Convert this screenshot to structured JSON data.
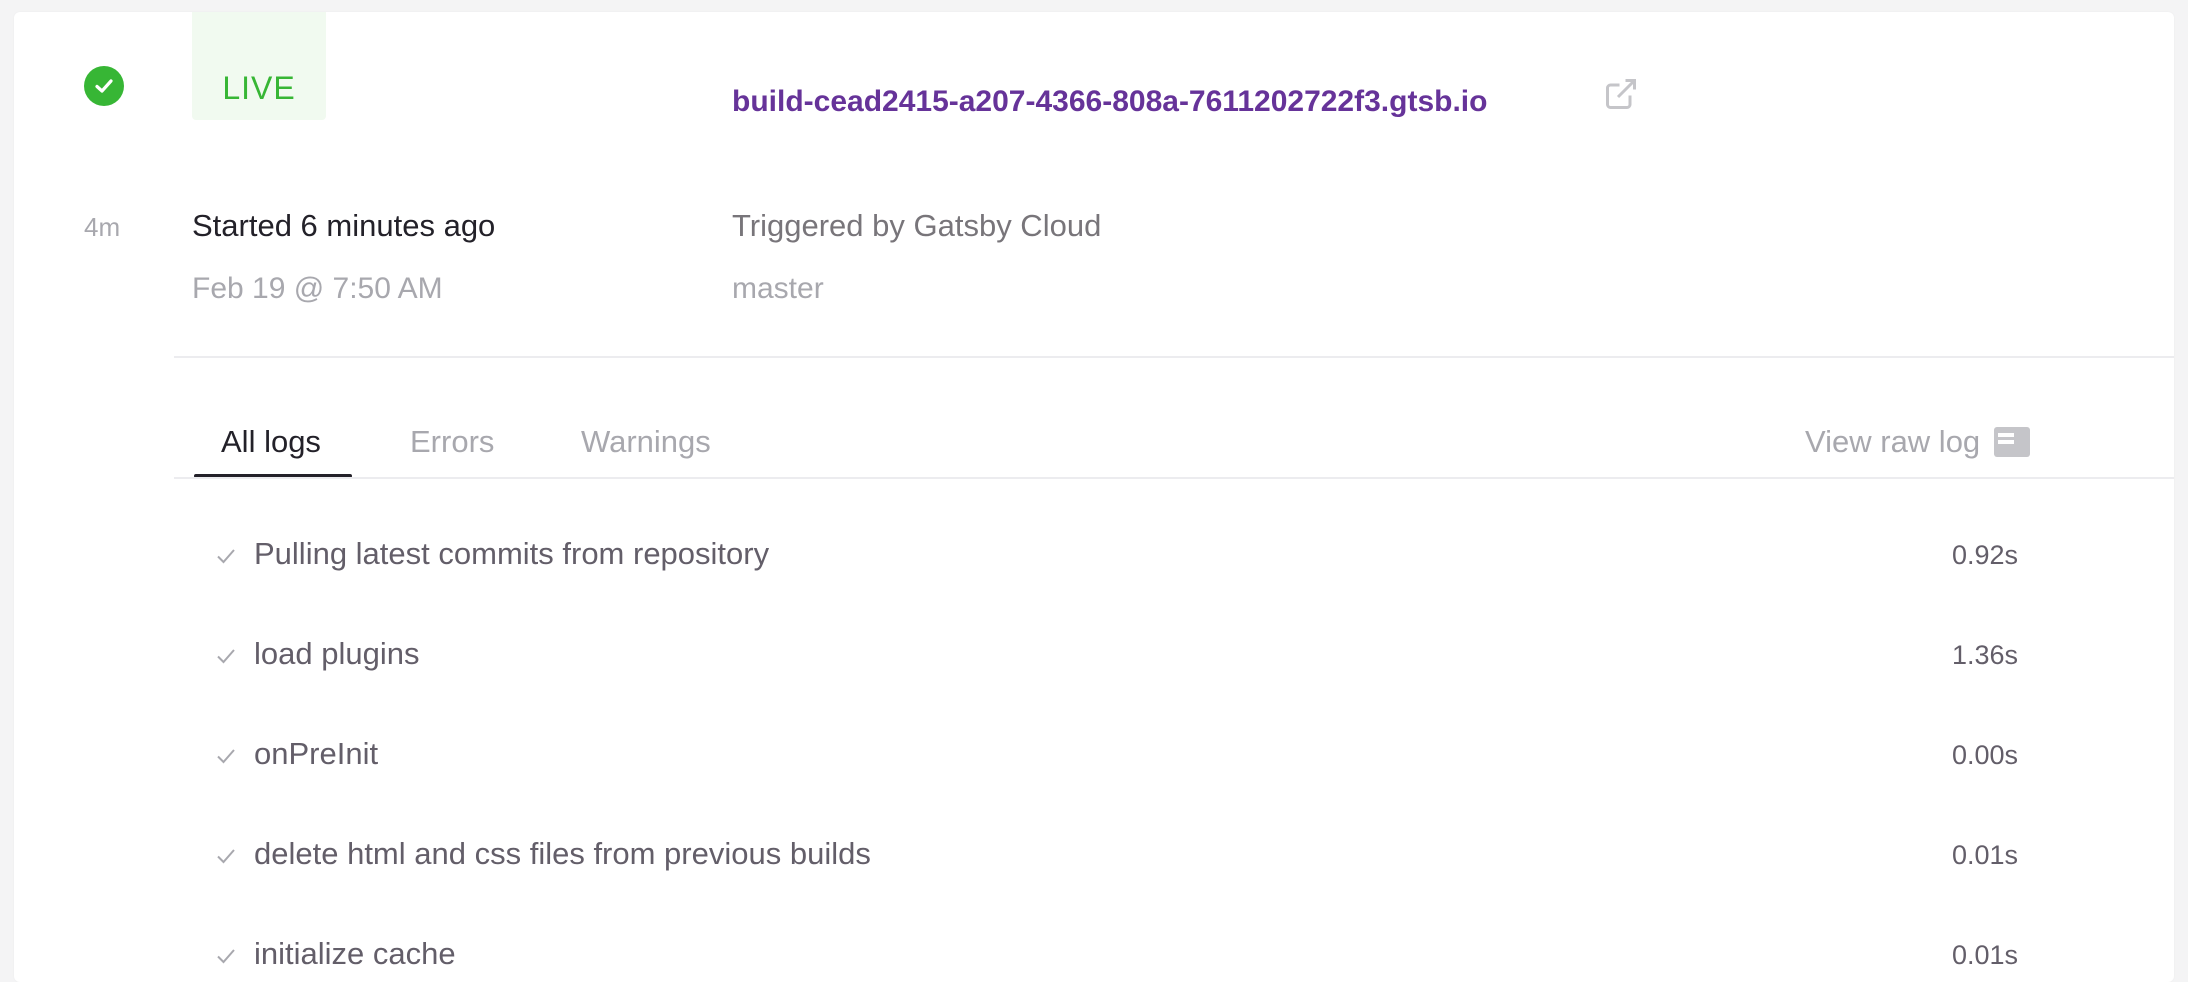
{
  "build": {
    "status_badge": "LIVE",
    "url": "build-cead2415-a207-4366-808a-7611202722f3.gtsb.io",
    "duration": "4m",
    "started": "Started 6 minutes ago",
    "date": "Feb 19 @ 7:50 AM",
    "triggered_by": "Triggered by Gatsby Cloud",
    "branch": "master"
  },
  "tabs": [
    {
      "label": "All logs",
      "active": true
    },
    {
      "label": "Errors",
      "active": false
    },
    {
      "label": "Warnings",
      "active": false
    }
  ],
  "raw_log_label": "View raw log",
  "logs": [
    {
      "label": "Pulling latest commits from repository",
      "time": "0.92s"
    },
    {
      "label": "load plugins",
      "time": "1.36s"
    },
    {
      "label": "onPreInit",
      "time": "0.00s"
    },
    {
      "label": "delete html and css files from previous builds",
      "time": "0.01s"
    },
    {
      "label": "initialize cache",
      "time": "0.01s"
    }
  ],
  "colors": {
    "accent": "#663399",
    "success": "#37b635"
  },
  "icons": {
    "status": "check-circle-icon",
    "external_link": "external-link-icon",
    "raw_log": "document-icon",
    "log_step": "checkmark-icon"
  }
}
